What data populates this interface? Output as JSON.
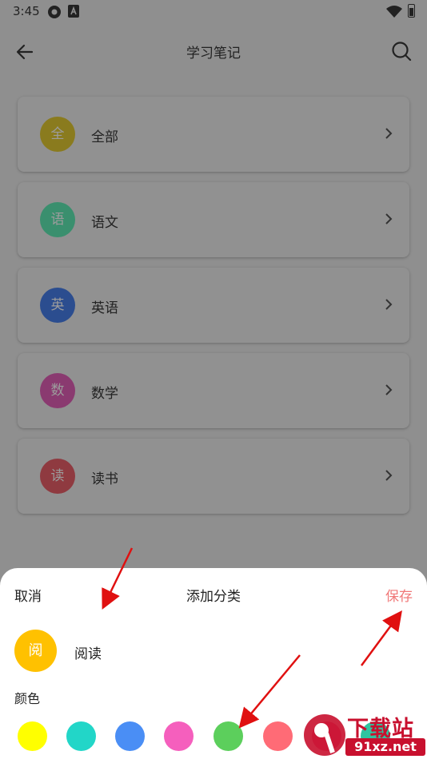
{
  "status_bar": {
    "time": "3:45"
  },
  "app_bar": {
    "title": "学习笔记"
  },
  "categories": [
    {
      "badge": "全",
      "name": "全部",
      "color": "#8a7b1e"
    },
    {
      "badge": "语",
      "name": "语文",
      "color": "#3a8f6e"
    },
    {
      "badge": "英",
      "name": "英语",
      "color": "#2b4d8f"
    },
    {
      "badge": "数",
      "name": "数学",
      "color": "#8a3a70"
    },
    {
      "badge": "读",
      "name": "读书",
      "color": "#8f3a40"
    }
  ],
  "sheet": {
    "cancel_label": "取消",
    "title": "添加分类",
    "save_label": "保存",
    "save_color": "#f07878",
    "preview_badge": "阅",
    "preview_color": "#ffc100",
    "name_value": "阅读",
    "color_label": "颜色",
    "swatches": [
      "#ffff00",
      "#22d6c8",
      "#4a8ef5",
      "#f55fbd",
      "#5ccf5c",
      "#ff6b76",
      "#f06292",
      "#2ec4a0"
    ]
  },
  "watermark": {
    "line1": "下载站",
    "line2": "91xz.net"
  }
}
